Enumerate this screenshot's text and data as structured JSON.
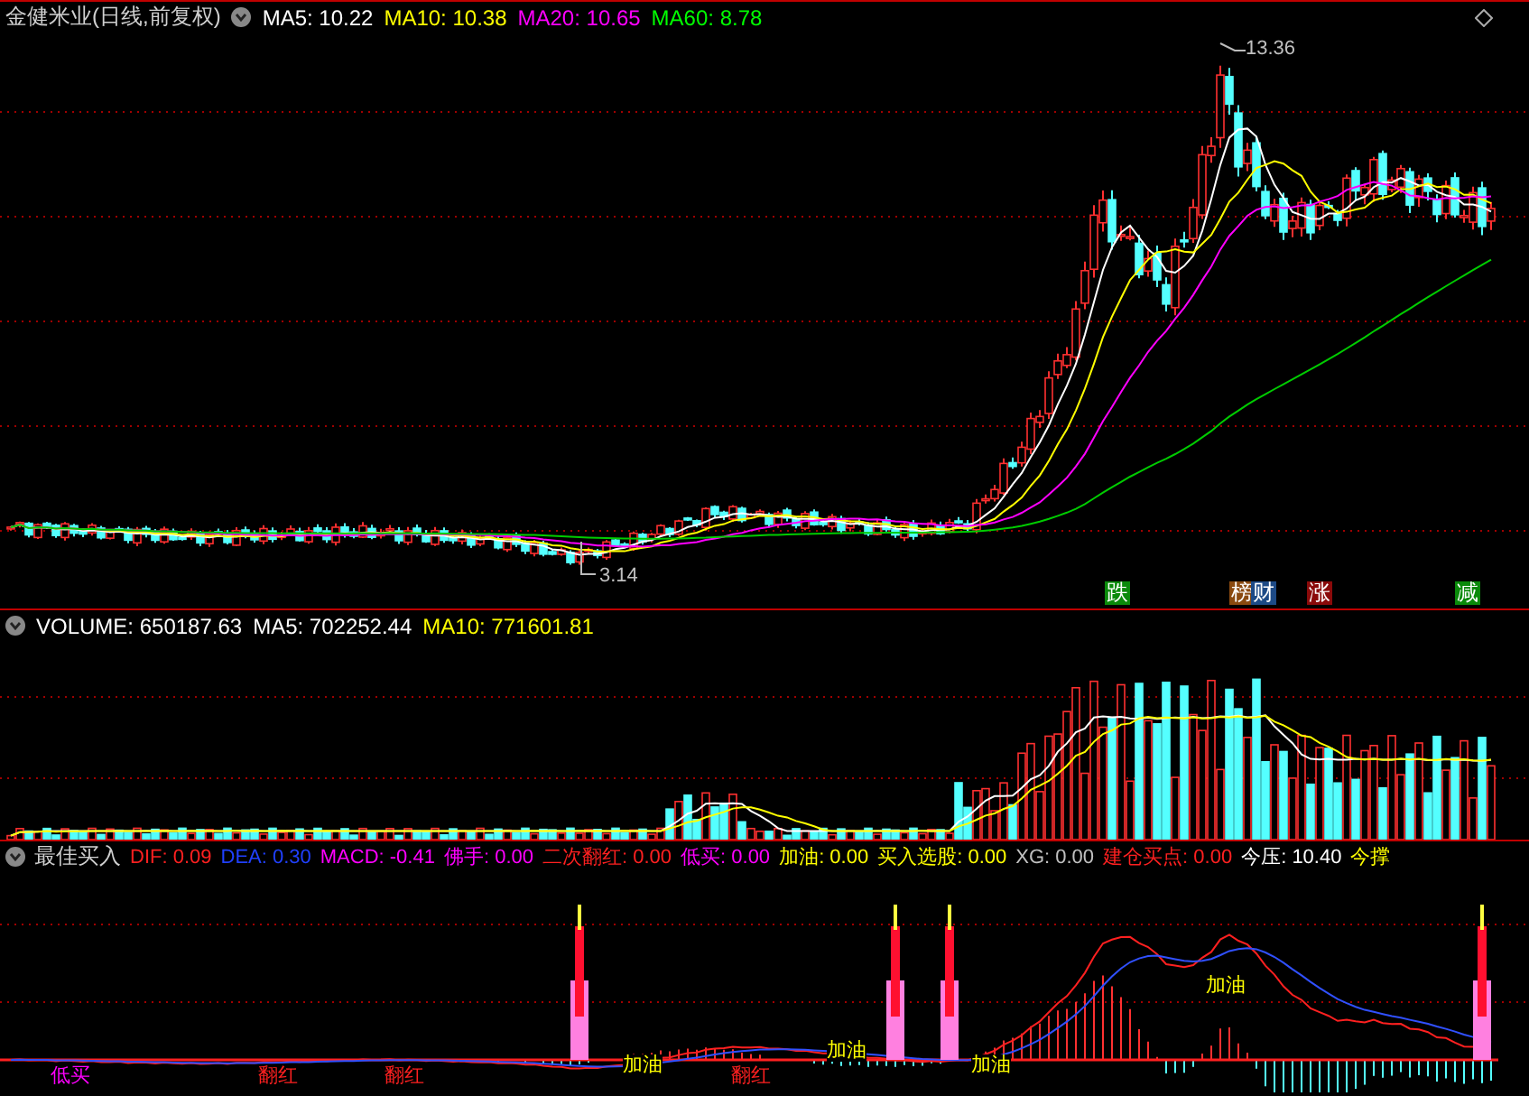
{
  "price_panel": {
    "title": "金健米业(日线,前复权)",
    "indicators": [
      {
        "label": "MA5: 10.22",
        "color": "#ffffff"
      },
      {
        "label": "MA10: 10.38",
        "color": "#ffff00"
      },
      {
        "label": "MA20: 10.65",
        "color": "#ff00ff"
      },
      {
        "label": "MA60: 8.78",
        "color": "#00ff00"
      }
    ],
    "high_label": "13.36",
    "low_label": "3.14",
    "signals": [
      {
        "text": "跌",
        "color": "#0a8a0a"
      },
      {
        "text": "榜",
        "color": "#8a4a10"
      },
      {
        "text": "财",
        "color": "#1d4a86"
      },
      {
        "text": "涨",
        "color": "#8a0a0a"
      },
      {
        "text": "减",
        "color": "#0a8a0a"
      }
    ]
  },
  "volume_panel": {
    "indicators": [
      {
        "label": "VOLUME: 650187.63",
        "color": "#ffffff"
      },
      {
        "label": "MA5: 702252.44",
        "color": "#ffffff"
      },
      {
        "label": "MA10: 771601.81",
        "color": "#ffff00"
      }
    ]
  },
  "indicator_panel": {
    "title": "最佳买入",
    "indicators": [
      {
        "label": "DIF: 0.09",
        "color": "#ff2020"
      },
      {
        "label": "DEA: 0.30",
        "color": "#2040ff"
      },
      {
        "label": "MACD: -0.41",
        "color": "#ff00ff"
      },
      {
        "label": "佛手: 0.00",
        "color": "#ff00ff"
      },
      {
        "label": "二次翻红: 0.00",
        "color": "#ff2020"
      },
      {
        "label": "低买: 0.00",
        "color": "#ff00ff"
      },
      {
        "label": "加油: 0.00",
        "color": "#ffff00"
      },
      {
        "label": "买入选股: 0.00",
        "color": "#ffff00"
      },
      {
        "label": "XG: 0.00",
        "color": "#c0c0c0"
      },
      {
        "label": "建仓买点: 0.00",
        "color": "#ff2020"
      },
      {
        "label": "今压: 10.40",
        "color": "#ffffff"
      },
      {
        "label": "今撑",
        "color": "#ffff00"
      }
    ],
    "markers": [
      {
        "kind": "low-buy",
        "text": "低买"
      },
      {
        "kind": "turn-red",
        "text": "翻红"
      },
      {
        "kind": "turn-red",
        "text": "翻红"
      },
      {
        "kind": "refuel",
        "text": "加油"
      },
      {
        "kind": "turn-red",
        "text": "翻红"
      },
      {
        "kind": "refuel",
        "text": "加油"
      },
      {
        "kind": "refuel",
        "text": "加油"
      },
      {
        "kind": "refuel",
        "text": "加油"
      }
    ]
  }
}
